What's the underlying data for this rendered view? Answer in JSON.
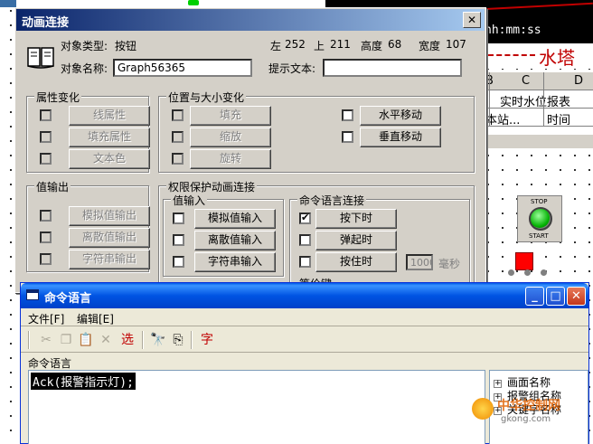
{
  "background": {
    "time_format": "hh:mm:ss",
    "tower_title": "水塔",
    "sheet": {
      "columns": [
        "B",
        "C",
        "D"
      ],
      "row1": "实时水位报表",
      "row2_col1": "本站...",
      "row2_col2": "时间"
    },
    "stop_button": {
      "top_label": "STOP",
      "bottom_label": "START"
    },
    "watermark": {
      "brand": "中华控制网",
      "url": "gkong.com"
    }
  },
  "animation_dialog": {
    "title": "动画连接",
    "close_glyph": "✕",
    "object_type_label": "对象类型:",
    "object_type_value": "按钮",
    "left_label": "左",
    "left_value": "252",
    "top_label": "上",
    "top_value": "211",
    "height_label": "高度",
    "height_value": "68",
    "width_label": "宽度",
    "width_value": "107",
    "object_name_label": "对象名称:",
    "object_name_value": "Graph56365",
    "hint_label": "提示文本:",
    "hint_value": "",
    "attr_group": {
      "title": "属性变化",
      "buttons": [
        "线属性",
        "填充属性",
        "文本色"
      ]
    },
    "pos_group": {
      "title": "位置与大小变化",
      "buttons_left": [
        "填充",
        "缩放",
        "旋转"
      ],
      "buttons_right": [
        "水平移动",
        "垂直移动"
      ]
    },
    "value_out_group": {
      "title": "值输出",
      "buttons": [
        "模拟值输出",
        "离散值输出",
        "字符串输出"
      ]
    },
    "perm_group": {
      "title": "权限保护动画连接",
      "value_in_title": "值输入",
      "value_in_buttons": [
        "模拟值输入",
        "离散值输入",
        "字符串输入"
      ],
      "command_title": "命令语言连接",
      "command_buttons": [
        "按下时",
        "弹起时",
        "按住时"
      ],
      "command_checked": [
        true,
        false,
        false
      ],
      "hold_ms_value": "1000",
      "hold_ms_unit": "毫秒",
      "equiv_key_label": "等价键"
    }
  },
  "command_dialog": {
    "title": "命令语言",
    "min_glyph": "_",
    "max_glyph": "□",
    "close_glyph": "✕",
    "menu": [
      "文件[F]",
      "编辑[E]"
    ],
    "toolbar": {
      "cut_icon": "✂",
      "copy_icon": "❐",
      "paste_icon": "📋",
      "delete_icon": "✕",
      "select_label": "选",
      "find_icon": "🔭",
      "replace_icon": "⎘",
      "font_label": "字"
    },
    "editor_label": "命令语言",
    "editor_text": "Ack(报警指示灯);",
    "tree_items": [
      "画面名称",
      "报警组名称",
      "关键字名称"
    ]
  }
}
